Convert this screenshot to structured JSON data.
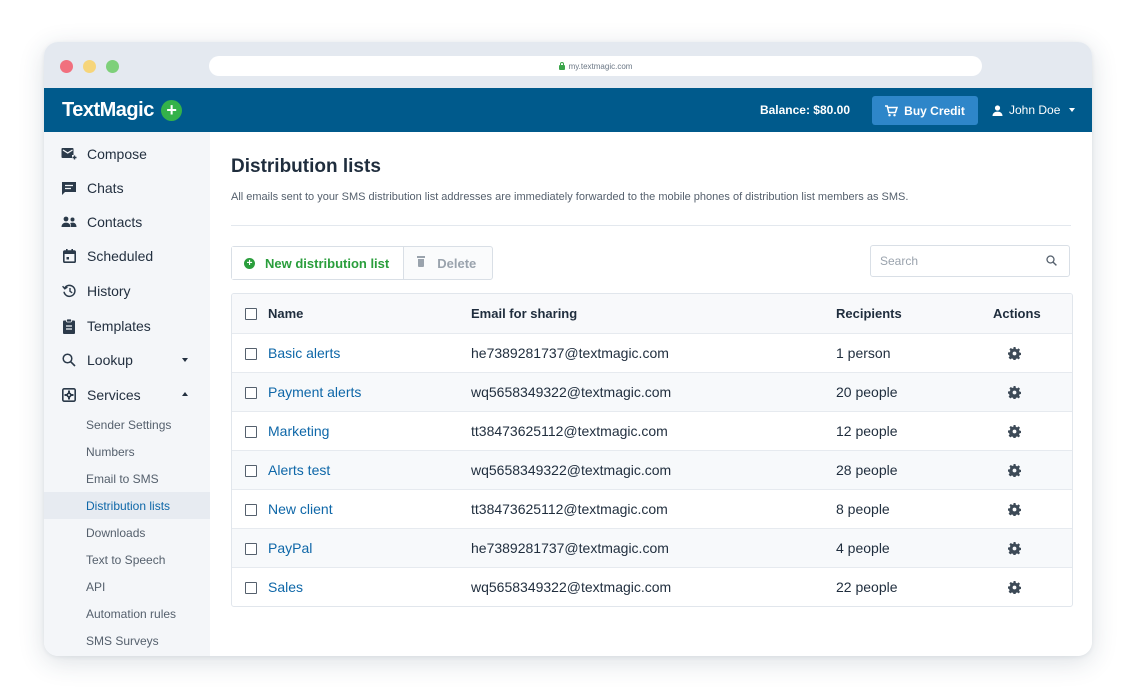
{
  "browser": {
    "url": "my.textmagic.com"
  },
  "topbar": {
    "logo": "TextMagic",
    "balance": "Balance: $80.00",
    "buy_credit": "Buy Credit",
    "user_name": "John Doe"
  },
  "sidebar": {
    "items": [
      {
        "label": "Compose",
        "icon": "compose-icon"
      },
      {
        "label": "Chats",
        "icon": "chat-icon"
      },
      {
        "label": "Contacts",
        "icon": "contacts-icon"
      },
      {
        "label": "Scheduled",
        "icon": "calendar-icon"
      },
      {
        "label": "History",
        "icon": "history-icon"
      },
      {
        "label": "Templates",
        "icon": "clipboard-icon"
      },
      {
        "label": "Lookup",
        "icon": "search-icon"
      },
      {
        "label": "Services",
        "icon": "services-icon"
      }
    ],
    "services_sub": [
      "Sender Settings",
      "Numbers",
      "Email to SMS",
      "Distribution lists",
      "Downloads",
      "Text to Speech",
      "API",
      "Automation rules",
      "SMS Surveys"
    ],
    "active_sub": "Distribution lists"
  },
  "main": {
    "title": "Distribution lists",
    "description": "All emails sent to your SMS distribution list addresses are immediately forwarded to the mobile phones of distribution list members as SMS.",
    "new_button": "New distribution list",
    "delete_button": "Delete",
    "search_placeholder": "Search",
    "table": {
      "headers": [
        "Name",
        "Email for sharing",
        "Recipients",
        "Actions"
      ],
      "rows": [
        {
          "name": "Basic alerts",
          "email": "he7389281737@textmagic.com",
          "recipients": "1 person"
        },
        {
          "name": "Payment alerts",
          "email": "wq5658349322@textmagic.com",
          "recipients": "20 people"
        },
        {
          "name": "Marketing",
          "email": "tt38473625112@textmagic.com",
          "recipients": "12 people"
        },
        {
          "name": "Alerts test",
          "email": "wq5658349322@textmagic.com",
          "recipients": "28 people"
        },
        {
          "name": "New client",
          "email": "tt38473625112@textmagic.com",
          "recipients": "8 people"
        },
        {
          "name": "PayPal",
          "email": "he7389281737@textmagic.com",
          "recipients": "4 people"
        },
        {
          "name": "Sales",
          "email": "wq5658349322@textmagic.com",
          "recipients": "22 people"
        }
      ]
    }
  },
  "colors": {
    "topbar": "#005a8c",
    "buy_credit": "#2e86c9",
    "accent_green": "#2a9e3c",
    "link": "#0e67a8"
  }
}
